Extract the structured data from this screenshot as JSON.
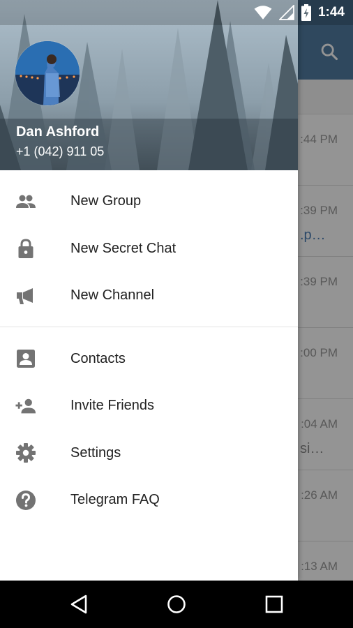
{
  "status_bar": {
    "time": "1:44",
    "icons": [
      "wifi-icon",
      "signal-icon",
      "battery-charging-icon"
    ]
  },
  "background": {
    "toolbar_icon": "search-icon",
    "chat_times": [
      ":44 PM",
      ":39 PM",
      ":39 PM",
      ":00 PM",
      ":04 AM",
      ":26 AM",
      ":13 AM"
    ],
    "chat_previews": [
      ".p…",
      "si…"
    ]
  },
  "drawer": {
    "user": {
      "name": "Dan Ashford",
      "phone": "+1 (042) 911 05"
    },
    "menu_primary": [
      {
        "label": "New Group",
        "icon": "group-icon"
      },
      {
        "label": "New Secret Chat",
        "icon": "lock-icon"
      },
      {
        "label": "New Channel",
        "icon": "megaphone-icon"
      }
    ],
    "menu_secondary": [
      {
        "label": "Contacts",
        "icon": "contacts-icon"
      },
      {
        "label": "Invite Friends",
        "icon": "add-person-icon"
      },
      {
        "label": "Settings",
        "icon": "gear-icon"
      },
      {
        "label": "Telegram FAQ",
        "icon": "help-icon"
      }
    ]
  },
  "nav_bar": {
    "buttons": [
      "back-icon",
      "home-icon",
      "recents-icon"
    ]
  },
  "colors": {
    "toolbar": "#527da3",
    "menu_icon": "#737373",
    "menu_text": "#222222",
    "link_preview": "#4a7db3"
  }
}
